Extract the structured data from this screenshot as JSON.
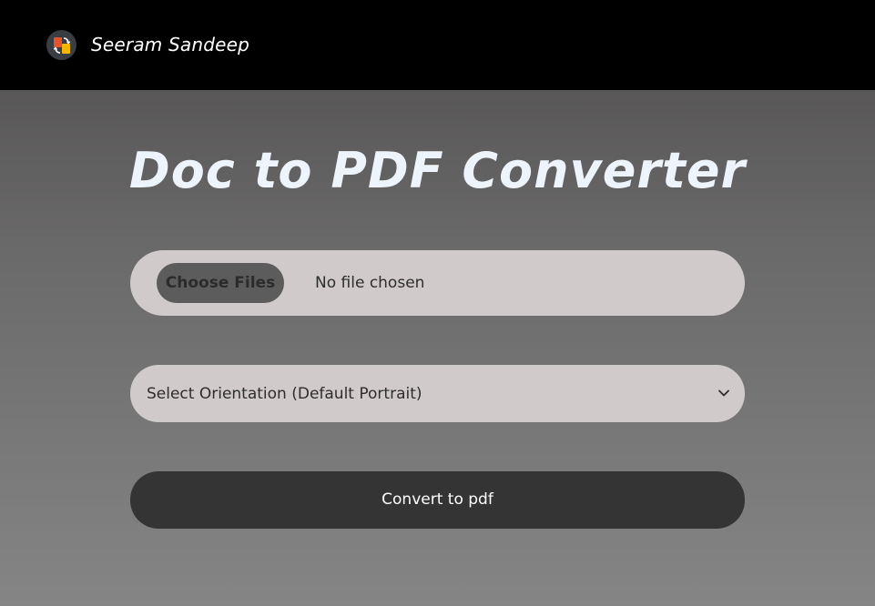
{
  "navbar": {
    "brand_name": "Seeram Sandeep",
    "logo_icon": "document-convert-icon"
  },
  "main": {
    "title": "Doc to PDF Converter",
    "file_input": {
      "button_label": "Choose Files",
      "status_text": "No file chosen"
    },
    "orientation_select": {
      "selected_value": "Select Orientation (Default Portrait)"
    },
    "convert_button_label": "Convert to pdf"
  },
  "colors": {
    "navbar_bg": "#000000",
    "title_color": "#eef4fb",
    "input_bg": "#d0cacb",
    "choose_button_bg": "#5c5c5c",
    "convert_button_bg": "#343434"
  }
}
